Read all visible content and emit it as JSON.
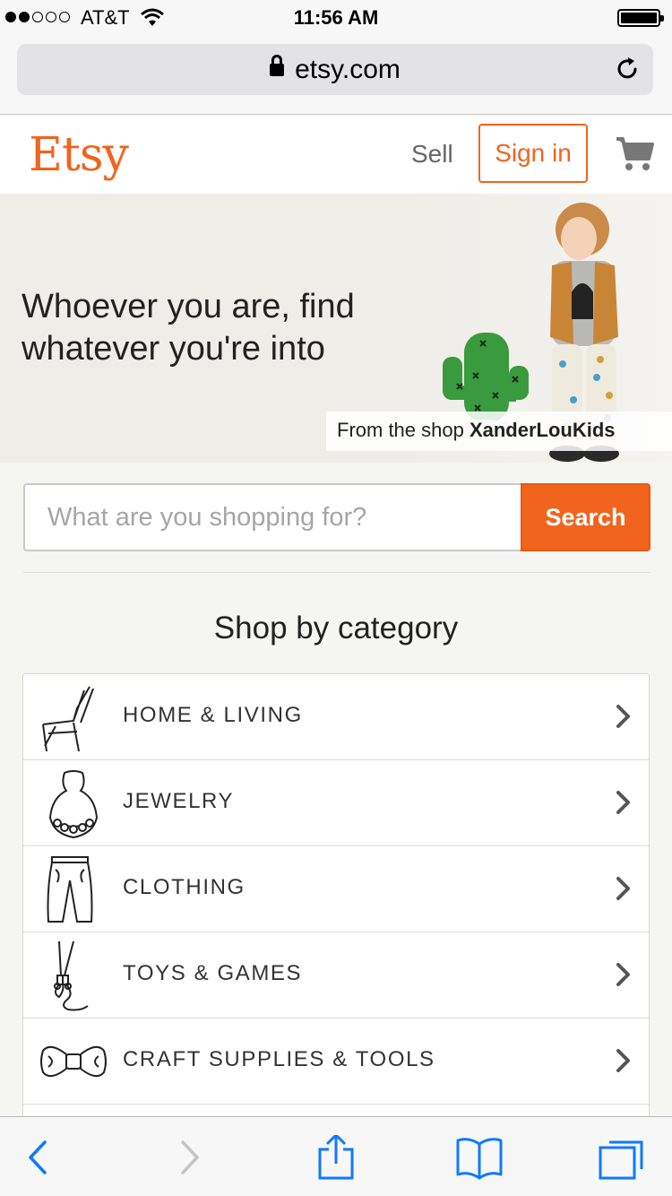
{
  "status_bar": {
    "carrier": "AT&T",
    "time": "11:56 AM",
    "signal_bars_filled": 2,
    "signal_bars_total": 5,
    "battery_level": 1.0
  },
  "browser": {
    "url": "etsy.com",
    "icons": [
      "lock-icon",
      "reload-icon",
      "back-icon",
      "forward-icon",
      "share-icon",
      "bookmarks-icon",
      "tabs-icon"
    ]
  },
  "header": {
    "logo": "Etsy",
    "sell_label": "Sell",
    "signin_label": "Sign in",
    "cart_icon": "cart-icon"
  },
  "hero": {
    "heading": "Whoever you are, find whatever you're into",
    "credit_prefix": "From the shop ",
    "credit_shop": "XanderLouKids"
  },
  "search": {
    "placeholder": "What are you shopping for?",
    "button_label": "Search"
  },
  "categories": {
    "title": "Shop by category",
    "items": [
      {
        "label": "HOME & LIVING",
        "icon": "chair-icon"
      },
      {
        "label": "JEWELRY",
        "icon": "necklace-icon"
      },
      {
        "label": "CLOTHING",
        "icon": "pants-icon"
      },
      {
        "label": "TOYS & GAMES",
        "icon": "jump-rope-icon"
      },
      {
        "label": "CRAFT SUPPLIES & TOOLS",
        "icon": "bow-tie-icon"
      }
    ]
  },
  "colors": {
    "brand_orange": "#f1641e",
    "ios_blue": "#0e7afe",
    "background": "#f5f5f1"
  }
}
